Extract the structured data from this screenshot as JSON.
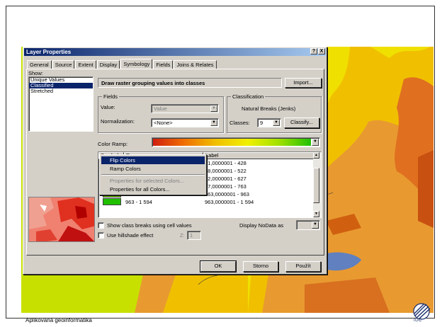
{
  "footer": {
    "text": "Aplikovaná geoinformatika",
    "logo_text": "IGC"
  },
  "dialog": {
    "title": "Layer Properties",
    "title_buttons": [
      "?",
      "X"
    ],
    "tabs": [
      {
        "label": "General",
        "active": false
      },
      {
        "label": "Source",
        "active": false
      },
      {
        "label": "Extent",
        "active": false
      },
      {
        "label": "Display",
        "active": false
      },
      {
        "label": "Symbology",
        "active": true
      },
      {
        "label": "Fields",
        "active": false
      },
      {
        "label": "Joins & Relates",
        "active": false
      }
    ],
    "show_label": "Show:",
    "show_items": [
      {
        "label": "Unique Values",
        "selected": false
      },
      {
        "label": "Classified",
        "selected": true
      },
      {
        "label": "Stretched",
        "selected": false
      }
    ],
    "heading": "Draw raster grouping values into classes",
    "import_button": "Import...",
    "fields": {
      "group_title": "Fields",
      "value_label": "Value:",
      "value_value": "Value",
      "normalization_label": "Normalization:",
      "normalization_value": "<None>"
    },
    "classification": {
      "group_title": "Classification",
      "method": "Natural Breaks (Jenks)",
      "classes_label": "Classes:",
      "classes_value": "9",
      "classify_button": "Classify..."
    },
    "color_ramp_label": "Color Ramp:",
    "grid": {
      "col_symbol": "Symbol",
      "col_range": "Range",
      "col_label": "Label",
      "rows": [
        {
          "color": "#f0b000",
          "range": "",
          "label": "31,0000001 - 428"
        },
        {
          "color": "#f0d000",
          "range": "",
          "label": "28,0000001 - 522"
        },
        {
          "color": "#f0f000",
          "range": "",
          "label": "22,0000001 - 627"
        },
        {
          "color": "#b8e800",
          "range": "",
          "label": "27,0000001 - 763"
        },
        {
          "color": "#78d800",
          "range": "763 - 963",
          "label": "763,0000001 - 963"
        },
        {
          "color": "#20c000",
          "range": "963 - 1 594",
          "label": "963,0000001 - 1 594"
        }
      ]
    },
    "context_menu": {
      "items": [
        {
          "label": "Flip Colors",
          "state": "highlighted"
        },
        {
          "label": "Ramp Colors",
          "state": "normal"
        },
        {
          "label": "Properties for selected Colors...",
          "state": "disabled"
        },
        {
          "label": "Properties for all Colors...",
          "state": "normal"
        }
      ]
    },
    "show_class_breaks_label": "Show class breaks using cell values",
    "display_nodata_label": "Display NoData as",
    "hillshade_label": "Use hillshade effect",
    "z_label": "Z:",
    "z_value": "1",
    "ok_button": "OK",
    "cancel_button": "Storno",
    "apply_button": "Použít"
  },
  "colors": {
    "titlebar": "#0a246a",
    "face": "#d4d0c8",
    "selection": "#0a246a"
  }
}
